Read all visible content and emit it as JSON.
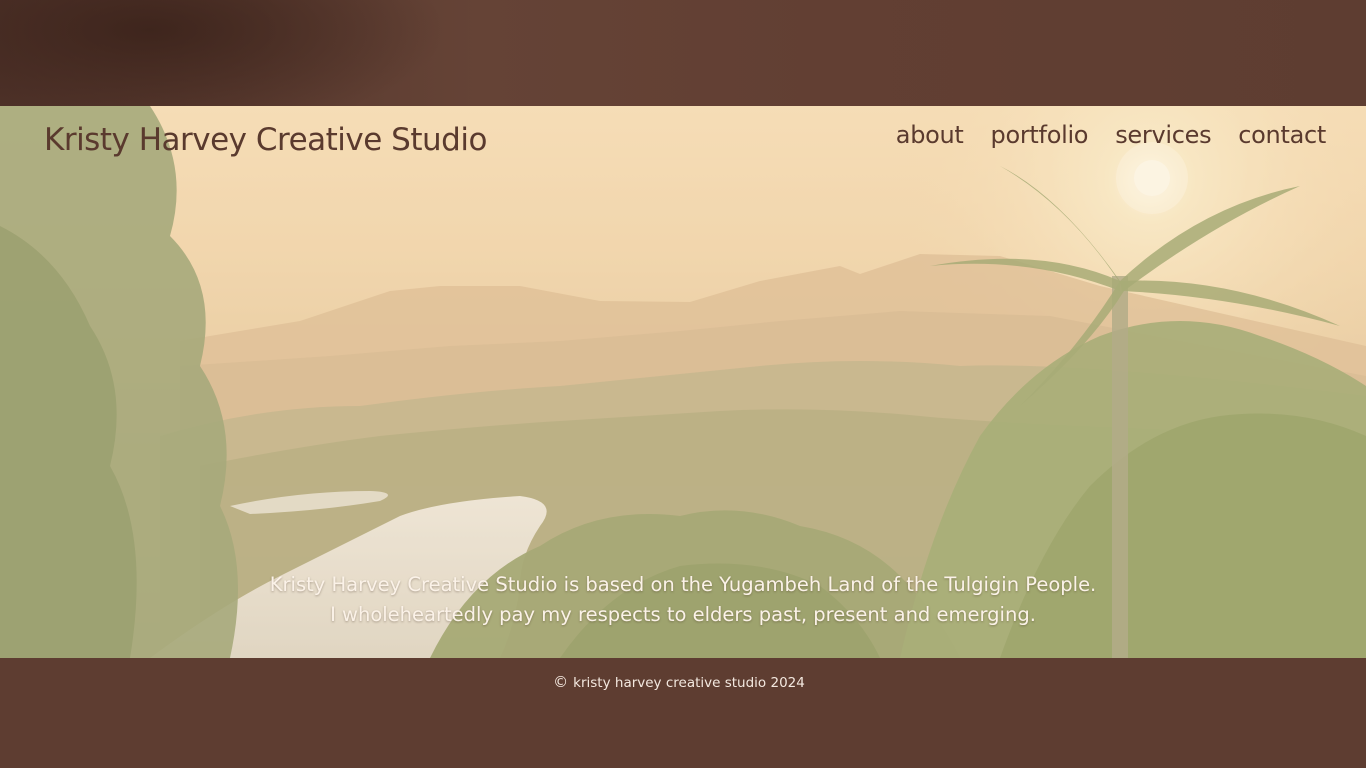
{
  "header": {
    "brand": "Kristy Harvey Creative Studio",
    "nav": [
      {
        "label": "about"
      },
      {
        "label": "portfolio"
      },
      {
        "label": "services"
      },
      {
        "label": "contact"
      }
    ]
  },
  "hero": {
    "image": "rainforest-valley-sunset-photo",
    "acknowledgement_line1": "Kristy Harvey Creative Studio is based on the Yugambeh Land of the Tulgigin People.",
    "acknowledgement_line2": "I wholeheartedly pay my respects to elders past, present and emerging."
  },
  "footer": {
    "copyright_symbol": "©",
    "copyright_text": "kristy harvey creative studio 2024"
  },
  "colors": {
    "brown": "#5e3d31",
    "text_dark": "#5a3a2e",
    "text_light": "#fbf2e8"
  }
}
